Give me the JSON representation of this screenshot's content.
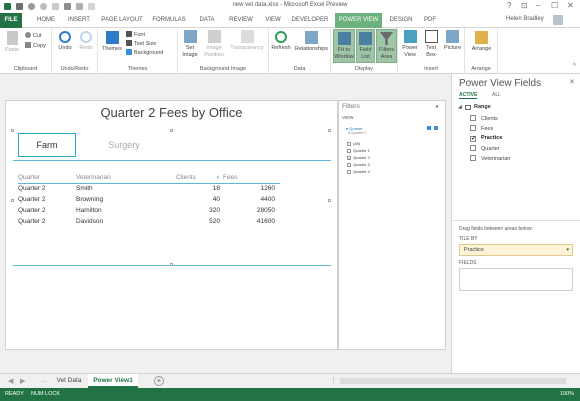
{
  "window": {
    "title": "new vet data.xlsx - Microsoft Excel Preview",
    "user": "Helen Bradley",
    "controls": [
      "?",
      "⊡",
      "–",
      "☐",
      "✕"
    ]
  },
  "tabs": [
    "FILE",
    "HOME",
    "INSERT",
    "PAGE LAYOUT",
    "FORMULAS",
    "DATA",
    "REVIEW",
    "VIEW",
    "DEVELOPER",
    "POWER VIEW",
    "DESIGN",
    "PDF"
  ],
  "ribbon": {
    "clipboard": {
      "paste": "Paste",
      "cut": "Cut",
      "copy": "Copy",
      "label": "Clipboard"
    },
    "undo_redo": {
      "undo": "Undo",
      "redo": "Redo",
      "label": "Undo/Redo"
    },
    "themes": {
      "themes": "Themes",
      "font": "Font",
      "text_size": "Text Size",
      "background": "Background",
      "label": "Themes"
    },
    "bg_image": {
      "set_image_1": "Set",
      "set_image_2": "Image",
      "image_position_1": "Image",
      "image_position_2": "Position",
      "transparency": "Transparency",
      "label": "Background Image"
    },
    "data": {
      "refresh": "Refresh",
      "relationships": "Relationships",
      "label": "Data"
    },
    "display": {
      "fit_1": "Fit to",
      "fit_2": "Window",
      "field_1": "Field",
      "field_2": "List",
      "filters_1": "Filters",
      "filters_2": "Area",
      "label": "Display"
    },
    "insert": {
      "power_1": "Power",
      "power_2": "View",
      "text_1": "Text",
      "text_2": "Box",
      "picture": "Picture",
      "label": "Insert"
    },
    "arrange": {
      "arrange": "Arrange",
      "label": "Arrange"
    }
  },
  "report": {
    "title": "Quarter 2 Fees by Office",
    "tiles": [
      "Farm",
      "Surgery"
    ],
    "columns": [
      "Quarter",
      "Veterinarian",
      "Clients",
      "Fees"
    ],
    "rows": [
      [
        "Quarter 2",
        "Smith",
        "18",
        "1260"
      ],
      [
        "Quarter 2",
        "Browning",
        "40",
        "4400"
      ],
      [
        "Quarter 2",
        "Hamilton",
        "320",
        "28050"
      ],
      [
        "Quarter 2",
        "Davidson",
        "520",
        "41600"
      ]
    ]
  },
  "filters": {
    "title": "Filters",
    "view": "VIEW",
    "quarter_label": "Quarter",
    "quarter_sub": "is Quarter 2",
    "options": [
      {
        "label": "(All)",
        "checked": false
      },
      {
        "label": "Quarter 1",
        "checked": false
      },
      {
        "label": "Quarter 2",
        "checked": true
      },
      {
        "label": "Quarter 3",
        "checked": false
      },
      {
        "label": "Quarter 4",
        "checked": false
      }
    ]
  },
  "fields_pane": {
    "title": "Power View Fields",
    "tab_active": "ACTIVE",
    "tab_all": "ALL",
    "range": "Range",
    "fields": [
      {
        "name": "Clients",
        "checked": false
      },
      {
        "name": "Fees",
        "checked": false
      },
      {
        "name": "Practice",
        "checked": true
      },
      {
        "name": "Quarter",
        "checked": false
      },
      {
        "name": "Veterinarian",
        "checked": false
      }
    ],
    "hint": "Drag fields between areas below:",
    "tile_by_label": "TILE BY",
    "tile_by_value": "Practice",
    "fields_label": "FIELDS"
  },
  "sheets": [
    "Vet Data",
    "Power View1"
  ],
  "status": {
    "ready": "READY",
    "num_lock": "NUM LOCK",
    "zoom": "100%"
  },
  "colors": {
    "excel_green": "#217346",
    "accent_blue": "#2aa4c8",
    "active_tab": "#6cb27e"
  }
}
